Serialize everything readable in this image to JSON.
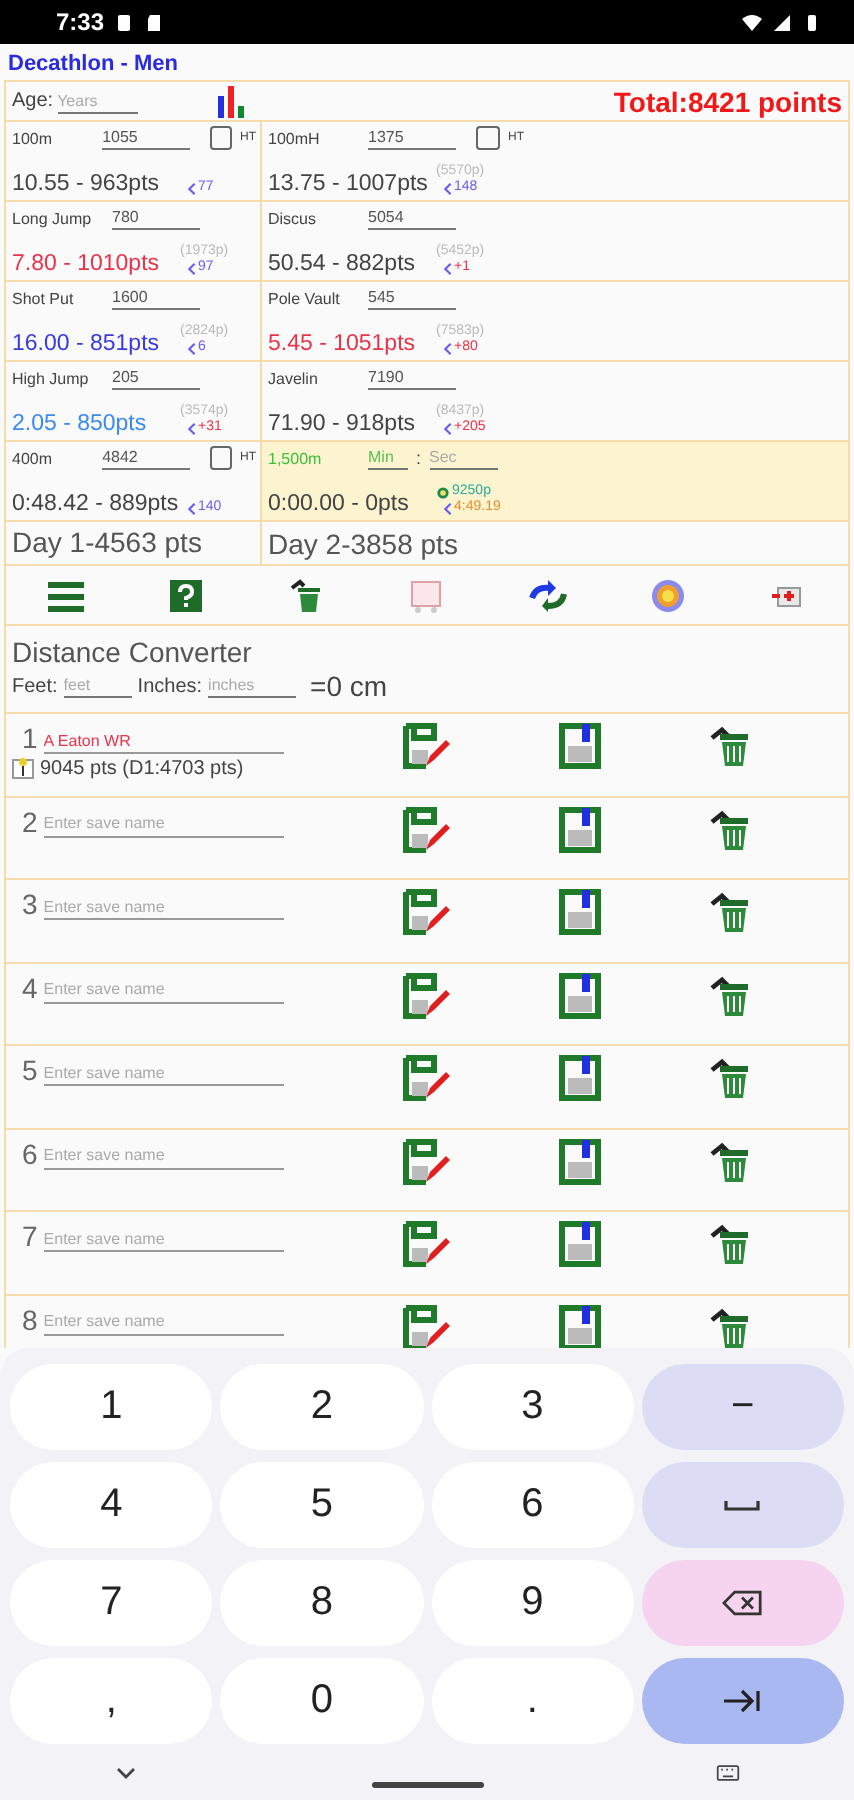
{
  "status_bar": {
    "time": "7:33"
  },
  "app_title": "Decathlon - Men",
  "age": {
    "label": "Age:",
    "placeholder": "Years"
  },
  "total": "Total:8421 points",
  "events": [
    {
      "kind": "timed",
      "name": "100m",
      "value": "1055",
      "ht_checked": false,
      "ht_label": "HT",
      "result": "10.55 - 963pts",
      "color": "#444444",
      "delta": {
        "text": "77",
        "color": "#6a5cf0"
      }
    },
    {
      "kind": "timed",
      "name": "100mH",
      "value": "1375",
      "ht_checked": false,
      "ht_label": "HT",
      "result": "13.75 - 1007pts",
      "projection": "(5570p)",
      "color": "#444444",
      "delta": {
        "text": "148",
        "color": "#6a5cf0"
      }
    },
    {
      "kind": "field",
      "name": "Long Jump",
      "value": "780",
      "result": "7.80 - 1010pts",
      "projection": "(1973p)",
      "color": "#e8334a",
      "delta": {
        "text": "97",
        "color": "#6a5cf0"
      }
    },
    {
      "kind": "field",
      "name": "Discus",
      "value": "5054",
      "result": "50.54 - 882pts",
      "projection": "(5452p)",
      "color": "#444444",
      "delta": {
        "text": "+1",
        "color": "#e8334a"
      }
    },
    {
      "kind": "field",
      "name": "Shot Put",
      "value": "1600",
      "result": "16.00 - 851pts",
      "projection": "(2824p)",
      "color": "#3a3ae0",
      "delta": {
        "text": "6",
        "color": "#6a5cf0"
      }
    },
    {
      "kind": "field",
      "name": "Pole Vault",
      "value": "545",
      "result": "5.45 - 1051pts",
      "projection": "(7583p)",
      "color": "#e8334a",
      "delta": {
        "text": "+80",
        "color": "#e8334a"
      }
    },
    {
      "kind": "field",
      "name": "High Jump",
      "value": "205",
      "result": "2.05 - 850pts",
      "projection": "(3574p)",
      "color": "#3a8af0",
      "delta": {
        "text": "+31",
        "color": "#e8334a"
      }
    },
    {
      "kind": "field",
      "name": "Javelin",
      "value": "7190",
      "result": "71.90 - 918pts",
      "projection": "(8437p)",
      "color": "#444444",
      "delta": {
        "text": "+205",
        "color": "#e8334a"
      }
    },
    {
      "kind": "timed",
      "name": "400m",
      "value": "4842",
      "ht_checked": false,
      "ht_label": "HT",
      "result": "0:48.42 - 889pts",
      "color": "#444444",
      "delta": {
        "text": "140",
        "color": "#6a5cf0"
      }
    },
    {
      "kind": "mile",
      "name": "1,500m",
      "min_placeholder": "Min",
      "separator": ":",
      "sec_placeholder": "Sec",
      "result": "0:00.00 - 0pts",
      "projection": "9250p",
      "color": "#444444",
      "delta": {
        "text": "4:49.19",
        "color": "#f08a2a"
      }
    }
  ],
  "day1": "Day 1-4563 pts",
  "day2": "Day 2-3858 pts",
  "converter": {
    "title": "Distance Converter",
    "feet_label": "Feet:",
    "feet_placeholder": "feet",
    "inches_label": "Inches:",
    "inches_placeholder": "inches",
    "result": "=0 cm"
  },
  "slots": [
    {
      "number": "1",
      "name": "A Eaton WR",
      "summary": "9045 pts (D1:4703 pts)"
    },
    {
      "number": "2",
      "placeholder": "Enter save name"
    },
    {
      "number": "3",
      "placeholder": "Enter save name"
    },
    {
      "number": "4",
      "placeholder": "Enter save name"
    },
    {
      "number": "5",
      "placeholder": "Enter save name"
    },
    {
      "number": "6",
      "placeholder": "Enter save name"
    },
    {
      "number": "7",
      "placeholder": "Enter save name"
    },
    {
      "number": "8",
      "placeholder": "Enter save name"
    }
  ],
  "keyboard": [
    {
      "kind": "digit",
      "label": "1"
    },
    {
      "kind": "digit",
      "label": "2"
    },
    {
      "kind": "digit",
      "label": "3"
    },
    {
      "kind": "symbol",
      "label": "−"
    },
    {
      "kind": "digit",
      "label": "4"
    },
    {
      "kind": "digit",
      "label": "5"
    },
    {
      "kind": "digit",
      "label": "6"
    },
    {
      "kind": "space"
    },
    {
      "kind": "digit",
      "label": "7"
    },
    {
      "kind": "digit",
      "label": "8"
    },
    {
      "kind": "digit",
      "label": "9"
    },
    {
      "kind": "delete"
    },
    {
      "kind": "digit",
      "label": ","
    },
    {
      "kind": "digit",
      "label": "0"
    },
    {
      "kind": "digit",
      "label": "."
    },
    {
      "kind": "enter"
    }
  ]
}
